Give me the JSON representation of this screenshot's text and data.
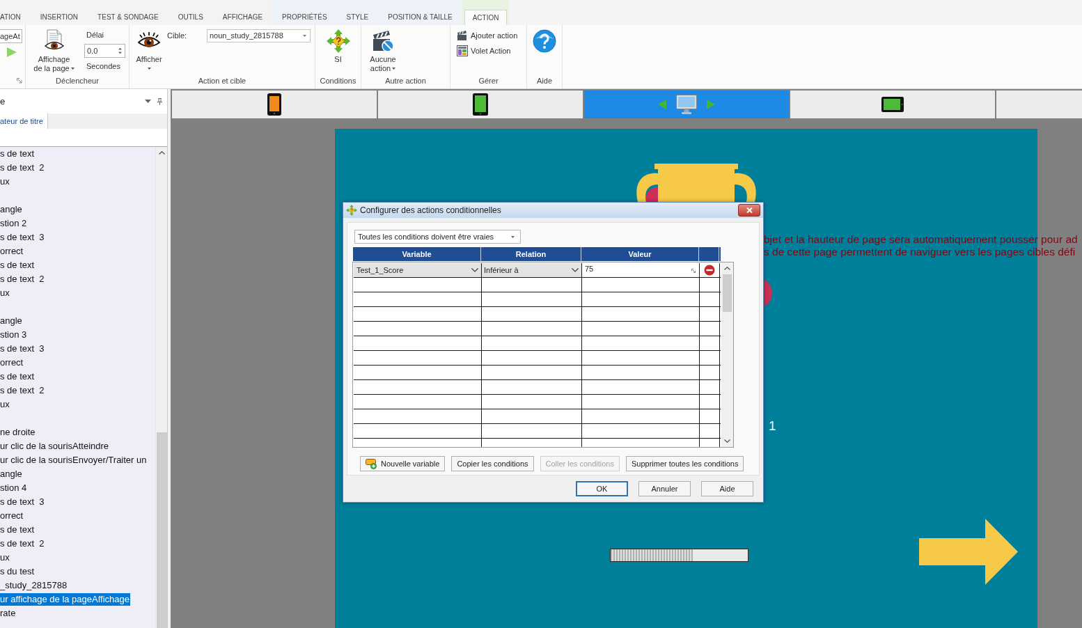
{
  "ribbon": {
    "tabs": [
      {
        "label": "ATION",
        "kind": "main",
        "selected": false
      },
      {
        "label": "INSERTION",
        "kind": "main",
        "selected": false
      },
      {
        "label": "TEST & SONDAGE",
        "kind": "main",
        "selected": false
      },
      {
        "label": "OUTILS",
        "kind": "main",
        "selected": false
      },
      {
        "label": "AFFICHAGE",
        "kind": "main",
        "selected": false
      },
      {
        "label": "PROPRIÉTÉS",
        "kind": "image",
        "selected": false
      },
      {
        "label": "STYLE",
        "kind": "image",
        "selected": false
      },
      {
        "label": "POSITION & TAILLE",
        "kind": "image",
        "selected": false
      },
      {
        "label": "ACTION",
        "kind": "action",
        "selected": true
      }
    ],
    "cut_group": {
      "field_value": "ageAt"
    },
    "trigger": {
      "label": "Déclencheur",
      "event_lines": [
        "Affichage",
        "de la page"
      ],
      "delay_label": "Délai",
      "delay_value": "0.0",
      "delay_unit": "Secondes"
    },
    "action_target": {
      "label": "Action et cible",
      "action_button": "Afficher",
      "target_label": "Cible:",
      "target_value": "noun_study_2815788"
    },
    "conditions": {
      "label": "Conditions",
      "button": "SI"
    },
    "other_action": {
      "label": "Autre action",
      "button_lines": [
        "Aucune",
        "action"
      ]
    },
    "manage": {
      "label": "Gérer",
      "items": [
        {
          "label": "Ajouter action",
          "kind": "add"
        },
        {
          "label": "Volet Action",
          "kind": "panel"
        }
      ]
    },
    "help": {
      "label": "Aide"
    }
  },
  "side_panel": {
    "title": "e",
    "tab": {
      "label": "ateur de titre",
      "selected": true
    },
    "items": [
      {
        "kind": "node",
        "label": "s de text",
        "selected": false
      },
      {
        "kind": "node",
        "label": "s de text  2",
        "selected": false
      },
      {
        "kind": "node",
        "label": "ux",
        "selected": false
      },
      {
        "kind": "blank"
      },
      {
        "kind": "node",
        "label": "angle",
        "selected": false
      },
      {
        "kind": "node",
        "label": "stion 2",
        "selected": false
      },
      {
        "kind": "node",
        "label": "s de text  3",
        "selected": false
      },
      {
        "kind": "node",
        "label": "orrect",
        "selected": false
      },
      {
        "kind": "node",
        "label": "s de text",
        "selected": false
      },
      {
        "kind": "node",
        "label": "s de text  2",
        "selected": false
      },
      {
        "kind": "node",
        "label": "ux",
        "selected": false
      },
      {
        "kind": "blank"
      },
      {
        "kind": "node",
        "label": "angle",
        "selected": false
      },
      {
        "kind": "node",
        "label": "stion 3",
        "selected": false
      },
      {
        "kind": "node",
        "label": "s de text  3",
        "selected": false
      },
      {
        "kind": "node",
        "label": "orrect",
        "selected": false
      },
      {
        "kind": "node",
        "label": "s de text",
        "selected": false
      },
      {
        "kind": "node",
        "label": "s de text  2",
        "selected": false
      },
      {
        "kind": "node",
        "label": "ux",
        "selected": false
      },
      {
        "kind": "blank"
      },
      {
        "kind": "node",
        "label": "ne droite",
        "selected": false
      },
      {
        "kind": "node",
        "label": "ur clic de la sourisAtteindre",
        "selected": false
      },
      {
        "kind": "node",
        "label": "ur clic de la sourisEnvoyer/Traiter un",
        "selected": false
      },
      {
        "kind": "node",
        "label": "angle",
        "selected": false
      },
      {
        "kind": "node",
        "label": "stion 4",
        "selected": false
      },
      {
        "kind": "node",
        "label": "s de text  3",
        "selected": false
      },
      {
        "kind": "node",
        "label": "orrect",
        "selected": false
      },
      {
        "kind": "node",
        "label": "s de text",
        "selected": false
      },
      {
        "kind": "node",
        "label": "s de text  2",
        "selected": false
      },
      {
        "kind": "node",
        "label": "ux",
        "selected": false
      },
      {
        "kind": "node",
        "label": "s du test",
        "selected": false
      },
      {
        "kind": "node",
        "label": "_study_2815788",
        "selected": false
      },
      {
        "kind": "node",
        "label": "ur affichage de la pageAffichage",
        "selected": true
      },
      {
        "kind": "node",
        "label": "rate",
        "selected": false
      }
    ]
  },
  "device_bar": [
    {
      "kind": "phone",
      "selected": false
    },
    {
      "kind": "tablet",
      "selected": false
    },
    {
      "kind": "desktop",
      "selected": true
    },
    {
      "kind": "tablet_landscape",
      "selected": false
    },
    {
      "kind": "cut",
      "selected": false
    }
  ],
  "page": {
    "notice_lines": [
      "bjet et la hauteur de page sera automatiquement pousser pour ad",
      "s de cette page permettent de naviguer vers les pages cibles défi"
    ],
    "page_number": "1",
    "progress": {
      "level": 0.6
    }
  },
  "dialog": {
    "title": "Configurer des actions conditionnelles",
    "mode": "Toutes les conditions doivent être vraies",
    "columns": [
      "Variable",
      "Relation",
      "Valeur"
    ],
    "rows": [
      {
        "variable": "Test_1_Score",
        "relation": "Inférieur à",
        "value": "75"
      }
    ],
    "buttons": [
      {
        "label": "Nouvelle variable",
        "kind": "variable",
        "disabled": false
      },
      {
        "label": "Copier les conditions",
        "kind": "plain",
        "disabled": false
      },
      {
        "label": "Coller les conditions",
        "kind": "plain",
        "disabled": true
      },
      {
        "label": "Supprimer toutes les conditions",
        "kind": "plain",
        "disabled": false
      }
    ],
    "footer_buttons": [
      {
        "label": "OK",
        "default": true
      },
      {
        "label": "Annuler",
        "default": false
      },
      {
        "label": "Aide",
        "default": false
      }
    ]
  }
}
